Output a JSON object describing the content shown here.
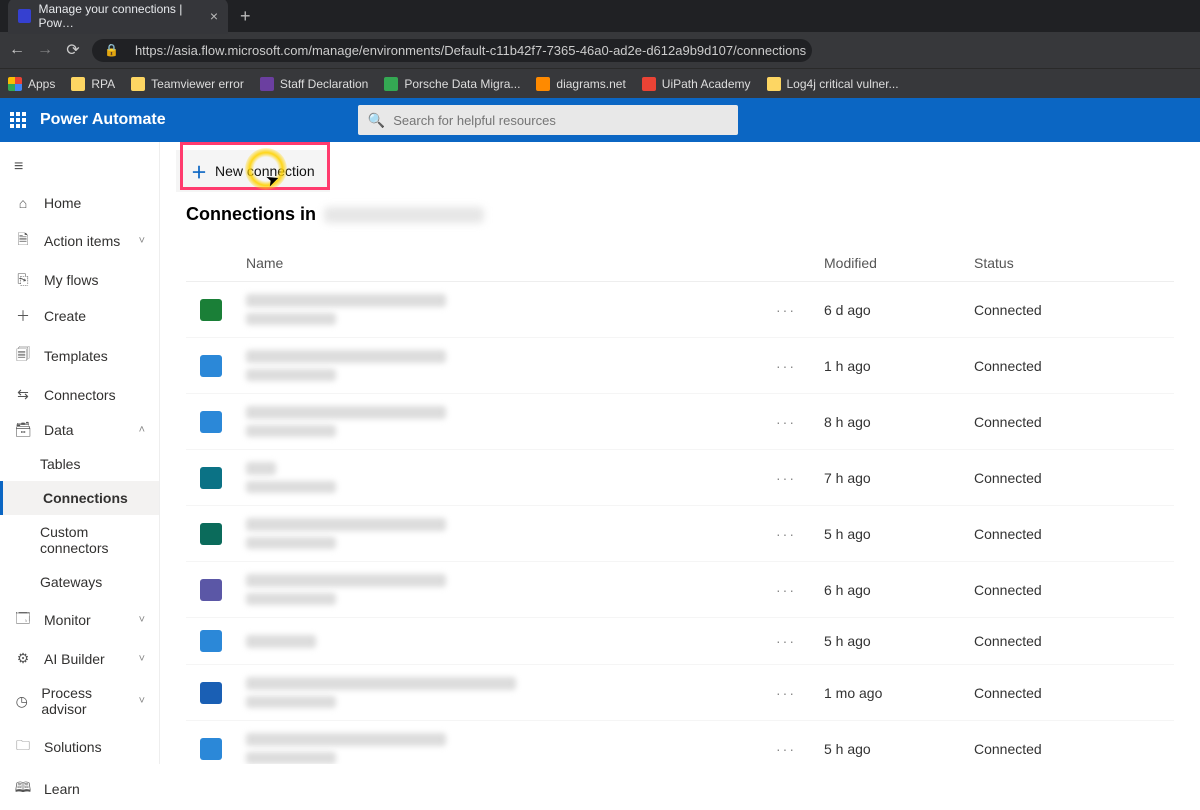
{
  "browser": {
    "tab_title": "Manage your connections | Pow…",
    "url": "https://asia.flow.microsoft.com/manage/environments/Default-c11b42f7-7365-46a0-ad2e-d612a9b9d107/connections"
  },
  "bookmarks": [
    {
      "label": "Apps",
      "iconClass": "apps"
    },
    {
      "label": "RPA",
      "iconClass": "yellow"
    },
    {
      "label": "Teamviewer error",
      "iconClass": "yellow"
    },
    {
      "label": "Staff Declaration",
      "iconClass": "purple"
    },
    {
      "label": "Porsche Data Migra...",
      "iconClass": "multi"
    },
    {
      "label": "diagrams.net",
      "iconClass": "orange"
    },
    {
      "label": "UiPath Academy",
      "iconClass": "red"
    },
    {
      "label": "Log4j critical vulner...",
      "iconClass": "yellow"
    }
  ],
  "header": {
    "app_name": "Power Automate",
    "search_placeholder": "Search for helpful resources"
  },
  "sidebar": {
    "items": [
      {
        "icon": "≡",
        "label": "",
        "type": "hamburger"
      },
      {
        "icon": "⌂",
        "label": "Home"
      },
      {
        "icon": "🗎",
        "label": "Action items",
        "expandable": true
      },
      {
        "icon": "⎘",
        "label": "My flows"
      },
      {
        "icon": "＋",
        "label": "Create"
      },
      {
        "icon": "🗐",
        "label": "Templates"
      },
      {
        "icon": "⇆",
        "label": "Connectors"
      },
      {
        "icon": "🗃",
        "label": "Data",
        "expandable": true,
        "expanded": true
      },
      {
        "icon": "",
        "label": "Tables",
        "sub": true
      },
      {
        "icon": "",
        "label": "Connections",
        "sub": true,
        "active": true
      },
      {
        "icon": "",
        "label": "Custom connectors",
        "sub": true
      },
      {
        "icon": "",
        "label": "Gateways",
        "sub": true
      },
      {
        "icon": "🗔",
        "label": "Monitor",
        "expandable": true
      },
      {
        "icon": "⚙",
        "label": "AI Builder",
        "expandable": true
      },
      {
        "icon": "◷",
        "label": "Process advisor",
        "expandable": true
      },
      {
        "icon": "🗀",
        "label": "Solutions"
      },
      {
        "icon": "🕮",
        "label": "Learn"
      }
    ]
  },
  "toolbar": {
    "new_connection_label": "New connection"
  },
  "page": {
    "heading": "Connections in"
  },
  "table": {
    "columns": {
      "name": "Name",
      "modified": "Modified",
      "status": "Status"
    },
    "rows": [
      {
        "iconClass": "c-green",
        "modified": "6 d ago",
        "status": "Connected"
      },
      {
        "iconClass": "c-blue",
        "modified": "1 h ago",
        "status": "Connected"
      },
      {
        "iconClass": "c-blue",
        "modified": "8 h ago",
        "status": "Connected"
      },
      {
        "iconClass": "c-teal",
        "modified": "7 h ago",
        "status": "Connected",
        "short": true
      },
      {
        "iconClass": "c-dteal",
        "modified": "5 h ago",
        "status": "Connected"
      },
      {
        "iconClass": "c-purple",
        "modified": "6 h ago",
        "status": "Connected"
      },
      {
        "iconClass": "c-sblue",
        "modified": "5 h ago",
        "status": "Connected",
        "single": true
      },
      {
        "iconClass": "c-dkblue",
        "modified": "1 mo ago",
        "status": "Connected",
        "wide": true
      },
      {
        "iconClass": "c-blue",
        "modified": "5 h ago",
        "status": "Connected"
      }
    ]
  }
}
